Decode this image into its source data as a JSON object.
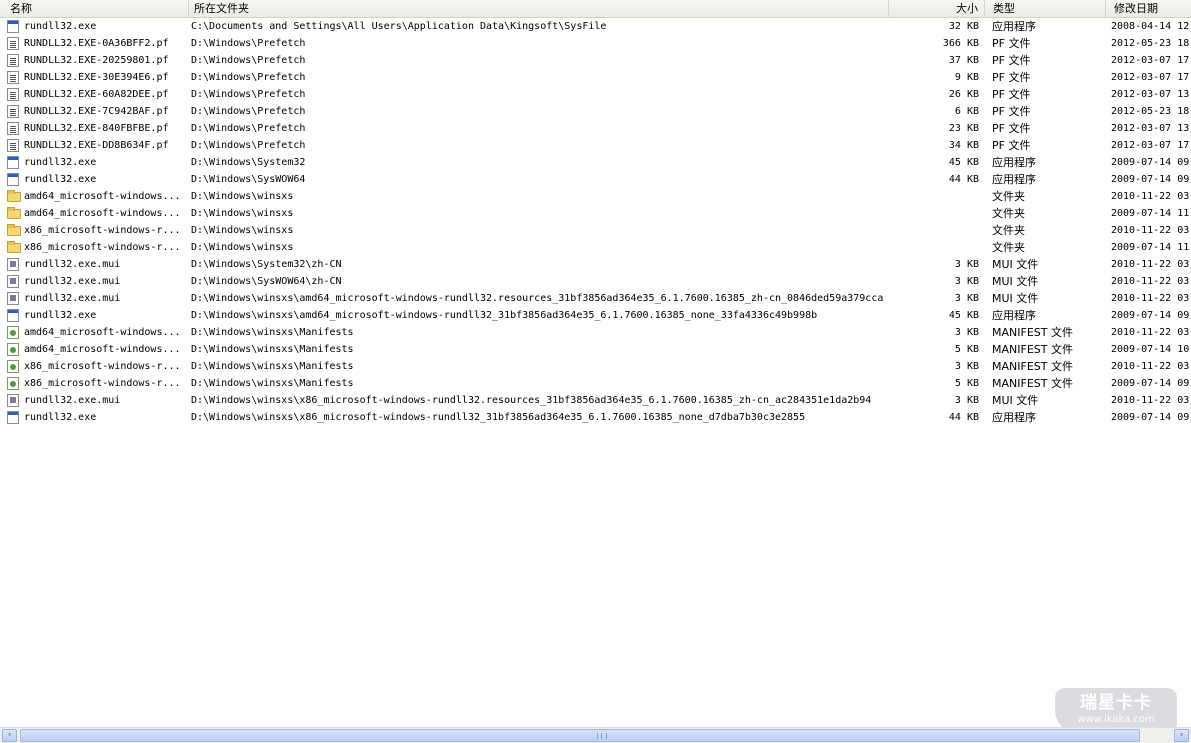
{
  "columns": {
    "name": "名称",
    "path": "所在文件夹",
    "size": "大小",
    "type": "类型",
    "date": "修改日期"
  },
  "rows": [
    {
      "icon": "exe-file-icon",
      "name": "rundll32.exe",
      "path": "C:\\Documents and Settings\\All Users\\Application Data\\Kingsoft\\SysFile",
      "size": "32 KB",
      "type": "应用程序",
      "date": "2008-04-14 12"
    },
    {
      "icon": "document-icon",
      "name": "RUNDLL32.EXE-0A36BFF2.pf",
      "path": "D:\\Windows\\Prefetch",
      "size": "366 KB",
      "type": "PF 文件",
      "date": "2012-05-23 18"
    },
    {
      "icon": "document-icon",
      "name": "RUNDLL32.EXE-20259801.pf",
      "path": "D:\\Windows\\Prefetch",
      "size": "37 KB",
      "type": "PF 文件",
      "date": "2012-03-07 17"
    },
    {
      "icon": "document-icon",
      "name": "RUNDLL32.EXE-30E394E6.pf",
      "path": "D:\\Windows\\Prefetch",
      "size": "9 KB",
      "type": "PF 文件",
      "date": "2012-03-07 17"
    },
    {
      "icon": "document-icon",
      "name": "RUNDLL32.EXE-60A82DEE.pf",
      "path": "D:\\Windows\\Prefetch",
      "size": "26 KB",
      "type": "PF 文件",
      "date": "2012-03-07 13"
    },
    {
      "icon": "document-icon",
      "name": "RUNDLL32.EXE-7C942BAF.pf",
      "path": "D:\\Windows\\Prefetch",
      "size": "6 KB",
      "type": "PF 文件",
      "date": "2012-05-23 18"
    },
    {
      "icon": "document-icon",
      "name": "RUNDLL32.EXE-840FBFBE.pf",
      "path": "D:\\Windows\\Prefetch",
      "size": "23 KB",
      "type": "PF 文件",
      "date": "2012-03-07 13"
    },
    {
      "icon": "document-icon",
      "name": "RUNDLL32.EXE-DD8B634F.pf",
      "path": "D:\\Windows\\Prefetch",
      "size": "34 KB",
      "type": "PF 文件",
      "date": "2012-03-07 17"
    },
    {
      "icon": "exe-file-icon",
      "name": "rundll32.exe",
      "path": "D:\\Windows\\System32",
      "size": "45 KB",
      "type": "应用程序",
      "date": "2009-07-14 09"
    },
    {
      "icon": "exe-file-icon",
      "name": "rundll32.exe",
      "path": "D:\\Windows\\SysWOW64",
      "size": "44 KB",
      "type": "应用程序",
      "date": "2009-07-14 09"
    },
    {
      "icon": "folder-icon",
      "name": "amd64_microsoft-windows...",
      "path": "D:\\Windows\\winsxs",
      "size": "",
      "type": "文件夹",
      "date": "2010-11-22 03"
    },
    {
      "icon": "folder-icon",
      "name": "amd64_microsoft-windows...",
      "path": "D:\\Windows\\winsxs",
      "size": "",
      "type": "文件夹",
      "date": "2009-07-14 11"
    },
    {
      "icon": "folder-icon",
      "name": "x86_microsoft-windows-r...",
      "path": "D:\\Windows\\winsxs",
      "size": "",
      "type": "文件夹",
      "date": "2010-11-22 03"
    },
    {
      "icon": "folder-icon",
      "name": "x86_microsoft-windows-r...",
      "path": "D:\\Windows\\winsxs",
      "size": "",
      "type": "文件夹",
      "date": "2009-07-14 11"
    },
    {
      "icon": "mui-file-icon",
      "name": "rundll32.exe.mui",
      "path": "D:\\Windows\\System32\\zh-CN",
      "size": "3 KB",
      "type": "MUI 文件",
      "date": "2010-11-22 03"
    },
    {
      "icon": "mui-file-icon",
      "name": "rundll32.exe.mui",
      "path": "D:\\Windows\\SysWOW64\\zh-CN",
      "size": "3 KB",
      "type": "MUI 文件",
      "date": "2010-11-22 03"
    },
    {
      "icon": "mui-file-icon",
      "name": "rundll32.exe.mui",
      "path": "D:\\Windows\\winsxs\\amd64_microsoft-windows-rundll32.resources_31bf3856ad364e35_6.1.7600.16385_zh-cn_0846ded59a379cca",
      "size": "3 KB",
      "type": "MUI 文件",
      "date": "2010-11-22 03"
    },
    {
      "icon": "exe-file-icon",
      "name": "rundll32.exe",
      "path": "D:\\Windows\\winsxs\\amd64_microsoft-windows-rundll32_31bf3856ad364e35_6.1.7600.16385_none_33fa4336c49b998b",
      "size": "45 KB",
      "type": "应用程序",
      "date": "2009-07-14 09"
    },
    {
      "icon": "manifest-file-icon",
      "name": "amd64_microsoft-windows...",
      "path": "D:\\Windows\\winsxs\\Manifests",
      "size": "3 KB",
      "type": "MANIFEST 文件",
      "date": "2010-11-22 03"
    },
    {
      "icon": "manifest-file-icon",
      "name": "amd64_microsoft-windows...",
      "path": "D:\\Windows\\winsxs\\Manifests",
      "size": "5 KB",
      "type": "MANIFEST 文件",
      "date": "2009-07-14 10"
    },
    {
      "icon": "manifest-file-icon",
      "name": "x86_microsoft-windows-r...",
      "path": "D:\\Windows\\winsxs\\Manifests",
      "size": "3 KB",
      "type": "MANIFEST 文件",
      "date": "2010-11-22 03"
    },
    {
      "icon": "manifest-file-icon",
      "name": "x86_microsoft-windows-r...",
      "path": "D:\\Windows\\winsxs\\Manifests",
      "size": "5 KB",
      "type": "MANIFEST 文件",
      "date": "2009-07-14 09"
    },
    {
      "icon": "mui-file-icon",
      "name": "rundll32.exe.mui",
      "path": "D:\\Windows\\winsxs\\x86_microsoft-windows-rundll32.resources_31bf3856ad364e35_6.1.7600.16385_zh-cn_ac284351e1da2b94",
      "size": "3 KB",
      "type": "MUI 文件",
      "date": "2010-11-22 03"
    },
    {
      "icon": "exe-file-icon",
      "name": "rundll32.exe",
      "path": "D:\\Windows\\winsxs\\x86_microsoft-windows-rundll32_31bf3856ad364e35_6.1.7600.16385_none_d7dba7b30c3e2855",
      "size": "44 KB",
      "type": "应用程序",
      "date": "2009-07-14 09"
    }
  ],
  "watermark": {
    "main": "瑞星卡卡",
    "sub": "www.ikaka.com"
  },
  "scrollbar": {
    "left_arrow": "‹",
    "right_arrow": "›"
  }
}
